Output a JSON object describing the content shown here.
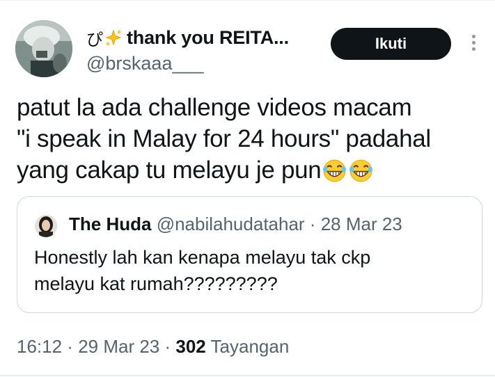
{
  "author": {
    "name_prefix": "ぴ",
    "display_name": "thank you REITA...",
    "username": "@brskaaa___",
    "follow_label": "Ikuti"
  },
  "tweet": {
    "lines": [
      "patut la ada challenge videos macam",
      "\"i speak in Malay for 24 hours\" padahal",
      "yang cakap tu melayu je pun"
    ]
  },
  "quote": {
    "name": "The Huda",
    "username": "@nabilahudatahar",
    "separator": " · ",
    "date": "28 Mar 23",
    "lines": [
      "Honestly lah kan kenapa melayu tak ckp",
      "melayu kat rumah?????????"
    ]
  },
  "meta": {
    "time": "16:12",
    "date": "29 Mar 23",
    "separator": " · ",
    "views": "302",
    "views_label": " Tayangan"
  },
  "icons": {
    "sparkle": "sparkles-icon",
    "emoji": "tears-of-joy-emoji",
    "more": "more-vertical-icon"
  },
  "colors": {
    "button_bg": "#0f1419",
    "secondary_text": "#536471",
    "sparkle_fill": "#ffc21c",
    "emoji_fill": "#ffcc33"
  }
}
